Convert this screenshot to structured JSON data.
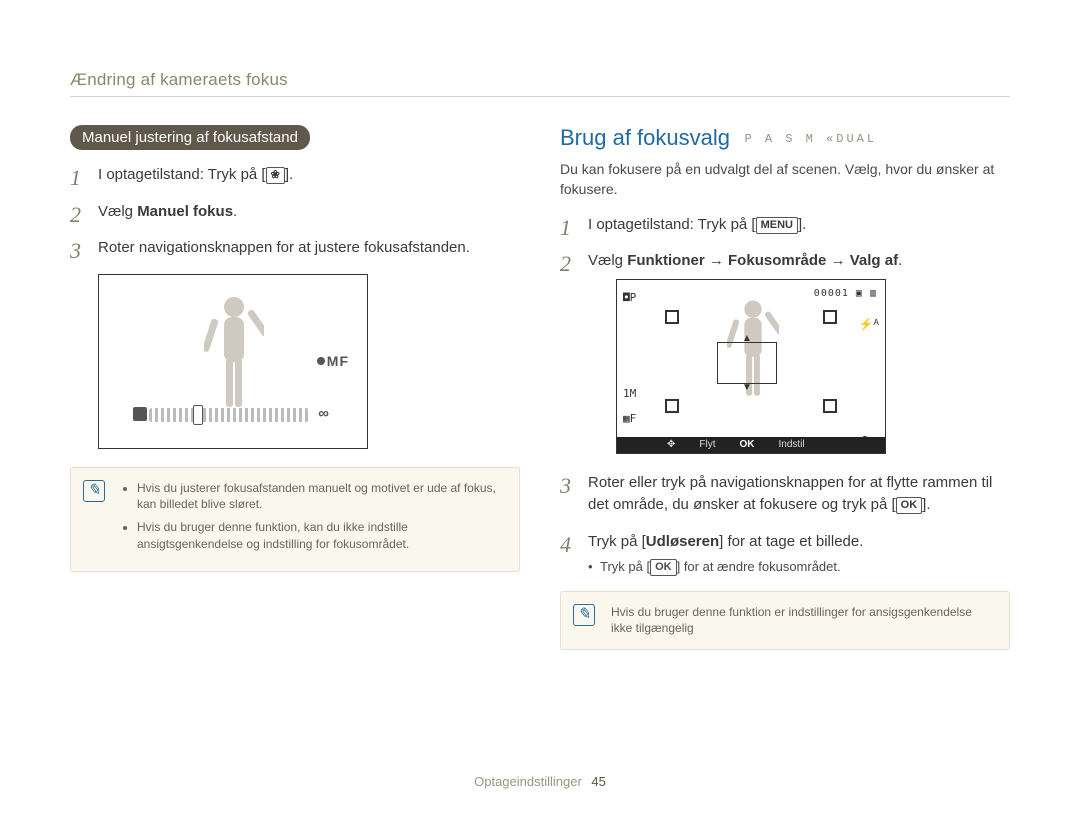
{
  "running_head": "Ændring af kameraets fokus",
  "left": {
    "pill": "Manuel justering af fokusafstand",
    "steps": [
      {
        "pre": "I optagetilstand: Tryk på [",
        "btn": "❀",
        "post": "]."
      },
      {
        "pre": "Vælg ",
        "bold": "Manuel fokus",
        "post": "."
      },
      {
        "pre": "Roter navigationsknappen for at justere fokusafstanden."
      }
    ],
    "fig_mf": "MF",
    "note": [
      "Hvis du justerer fokusafstanden manuelt og motivet er ude af fokus, kan billedet blive sløret.",
      "Hvis du bruger denne funktion, kan du ikke indstille ansigtsgenkendelse og indstilling for fokusområdet."
    ]
  },
  "right": {
    "title": "Brug af fokusvalg",
    "modes": "P A S M «DUAL",
    "intro": "Du kan fokusere på en udvalgt del af scenen. Vælg, hvor du ønsker at fokusere.",
    "steps": [
      {
        "pre": "I optagetilstand: Tryk på [",
        "btn": "MENU",
        "post": "]."
      },
      {
        "pre": "Vælg ",
        "bold": "Funktioner → Fokusområde → Valg af",
        "post": "."
      },
      {
        "pre": "Roter eller tryk på navigationsknappen for at flytte rammen til det område, du ønsker at fokusere og tryk på [",
        "btn": "OK",
        "post": "]."
      },
      {
        "pre": "Tryk på [",
        "bold2": "Udløseren",
        "post": "] for at tage et billede.",
        "sub": {
          "pre": "Tryk på [",
          "btn": "OK",
          "post": "] for at ændre fokusområdet."
        }
      }
    ],
    "fig": {
      "counter": "00001",
      "bar_move": "Flyt",
      "bar_ok": "OK",
      "bar_set": "Indstil"
    },
    "note": "Hvis du bruger denne funktion er indstillinger for ansigsgenkendelse ikke tilgængelig"
  },
  "footer": {
    "section": "Optageindstillinger",
    "page": "45"
  }
}
